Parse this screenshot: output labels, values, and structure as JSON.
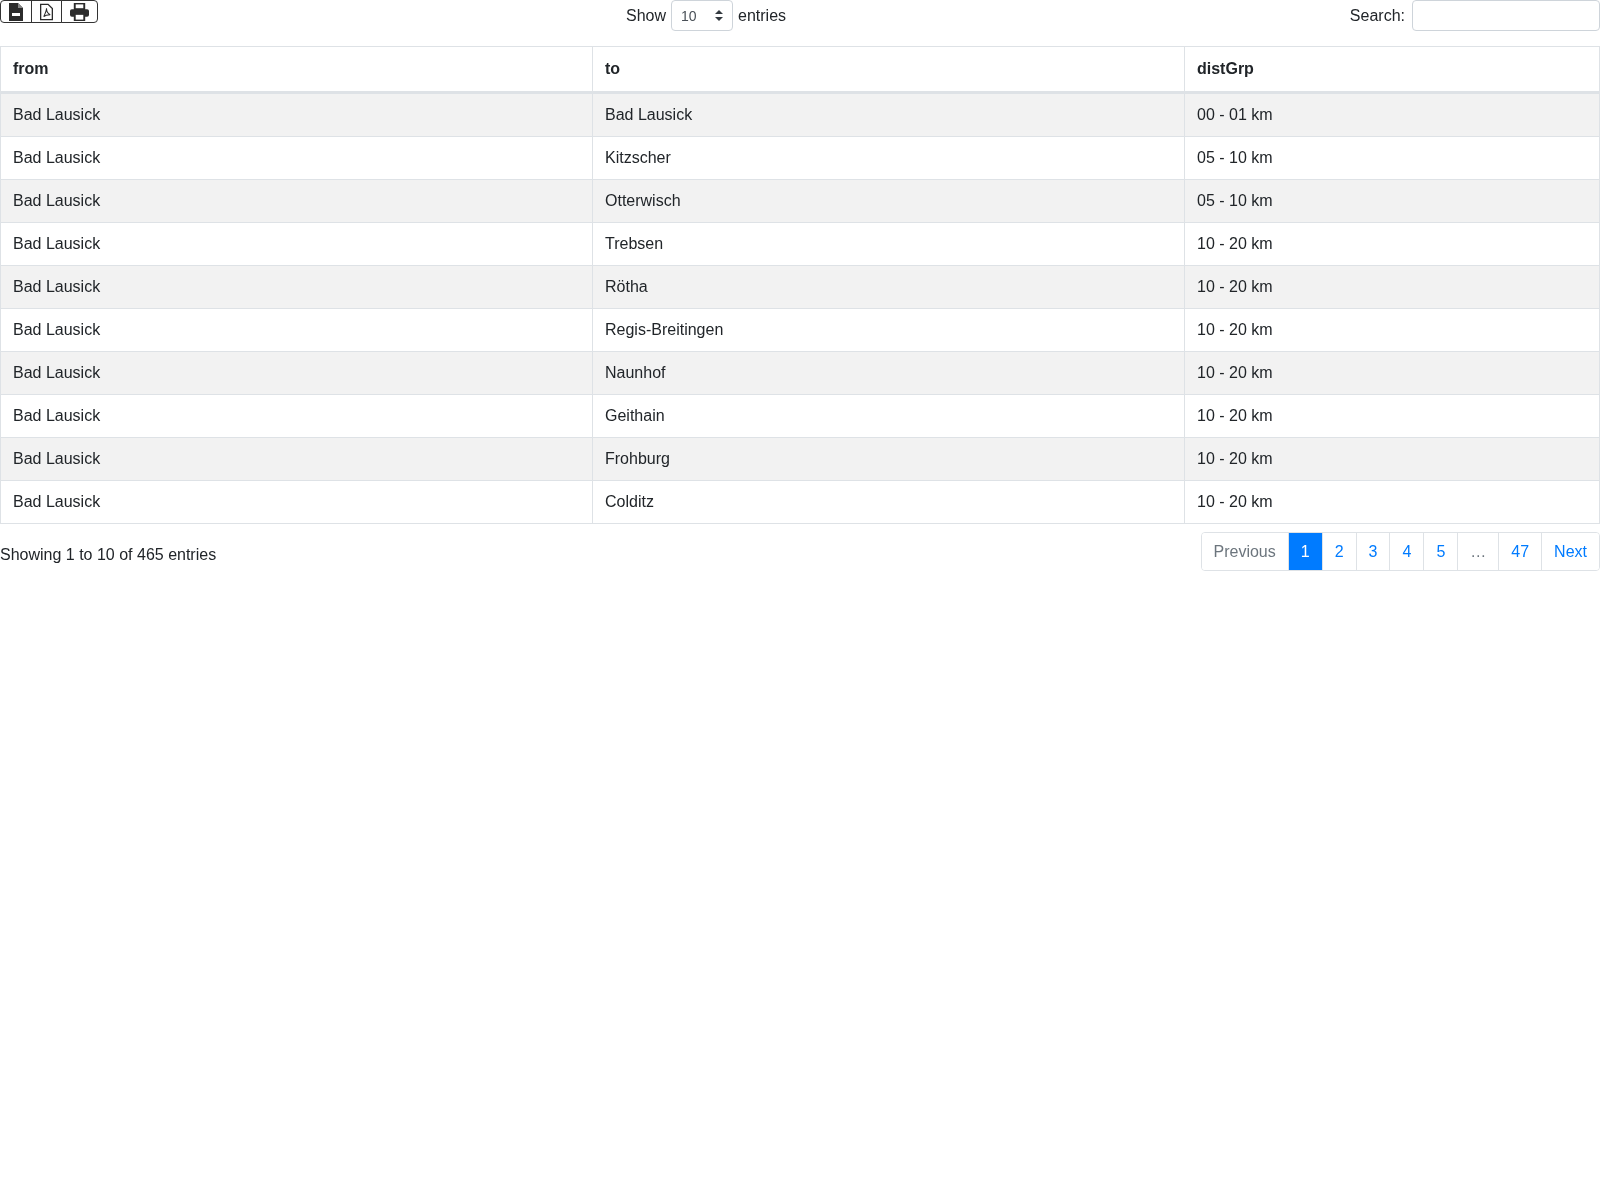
{
  "toolbar": {
    "show_label": "Show",
    "page_size": "10",
    "entries_label": "entries",
    "search_label": "Search:"
  },
  "table": {
    "columns": [
      "from",
      "to",
      "distGrp"
    ],
    "rows": [
      [
        "Bad Lausick",
        "Bad Lausick",
        "00 - 01 km"
      ],
      [
        "Bad Lausick",
        "Kitzscher",
        "05 - 10 km"
      ],
      [
        "Bad Lausick",
        "Otterwisch",
        "05 - 10 km"
      ],
      [
        "Bad Lausick",
        "Trebsen",
        "10 - 20 km"
      ],
      [
        "Bad Lausick",
        "Rötha",
        "10 - 20 km"
      ],
      [
        "Bad Lausick",
        "Regis-Breitingen",
        "10 - 20 km"
      ],
      [
        "Bad Lausick",
        "Naunhof",
        "10 - 20 km"
      ],
      [
        "Bad Lausick",
        "Geithain",
        "10 - 20 km"
      ],
      [
        "Bad Lausick",
        "Frohburg",
        "10 - 20 km"
      ],
      [
        "Bad Lausick",
        "Colditz",
        "10 - 20 km"
      ]
    ]
  },
  "info": "Showing 1 to 10 of 465 entries",
  "pagination": [
    {
      "label": "Previous",
      "disabled": true,
      "selected": false
    },
    {
      "label": "1",
      "disabled": false,
      "selected": true
    },
    {
      "label": "2",
      "disabled": false,
      "selected": false
    },
    {
      "label": "3",
      "disabled": false,
      "selected": false
    },
    {
      "label": "4",
      "disabled": false,
      "selected": false
    },
    {
      "label": "5",
      "disabled": false,
      "selected": false
    },
    {
      "label": "…",
      "disabled": true,
      "selected": false
    },
    {
      "label": "47",
      "disabled": false,
      "selected": false
    },
    {
      "label": "Next",
      "disabled": false,
      "selected": false
    }
  ]
}
